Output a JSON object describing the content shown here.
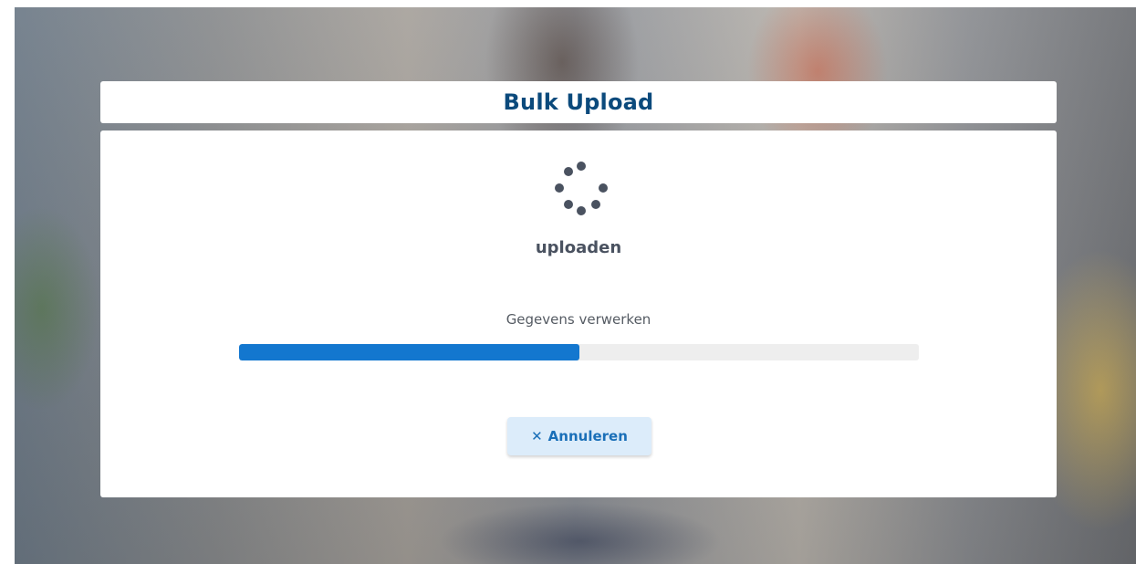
{
  "dialog": {
    "title": "Bulk Upload",
    "status": "uploaden",
    "step": "Gegevens verwerken",
    "progress_fraction": 0.5,
    "cancel_label": "Annuleren",
    "cancel_icon": "close-icon"
  },
  "colors": {
    "title": "#0b4a7c",
    "progress_fill": "#1377cf",
    "progress_track": "#eeeeee",
    "button_bg": "#dcecfa",
    "button_text": "#1a6fb8",
    "spinner_dot": "#4a5260"
  }
}
